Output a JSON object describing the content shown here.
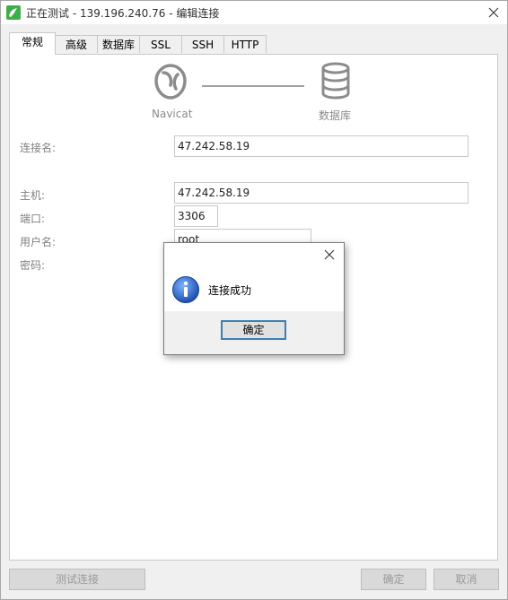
{
  "window": {
    "title": "正在测试 - 139.196.240.76 - 编辑连接"
  },
  "tabs": [
    {
      "label": "常规",
      "active": true
    },
    {
      "label": "高级",
      "active": false
    },
    {
      "label": "数据库",
      "active": false
    },
    {
      "label": "SSL",
      "active": false
    },
    {
      "label": "SSH",
      "active": false
    },
    {
      "label": "HTTP",
      "active": false
    }
  ],
  "diagram": {
    "left_label": "Navicat",
    "right_label": "数据库"
  },
  "form": {
    "connection_name_label": "连接名:",
    "connection_name_value": "47.242.58.19",
    "host_label": "主机:",
    "host_value": "47.242.58.19",
    "port_label": "端口:",
    "port_value": "3306",
    "username_label": "用户名:",
    "username_value": "root",
    "password_label": "密码:"
  },
  "buttons": {
    "test_connection": "测试连接",
    "ok": "确定",
    "cancel": "取消"
  },
  "dialog": {
    "message": "连接成功",
    "ok_label": "确定"
  },
  "icons": {
    "app": "navicat-app-icon",
    "close": "close-icon",
    "navicat": "navicat-logo-icon",
    "database": "database-icon",
    "info": "info-icon"
  },
  "colors": {
    "app_icon": "#3fae49",
    "info_icon": "#2a5fc4",
    "focus_border": "#3c7fb1"
  }
}
